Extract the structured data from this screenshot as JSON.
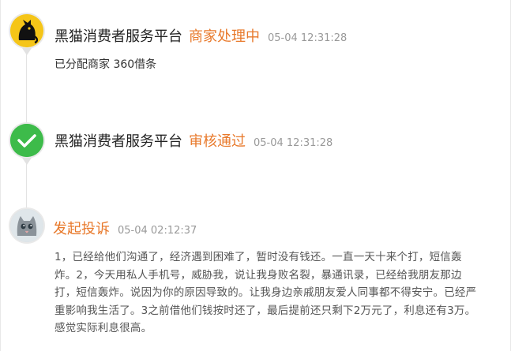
{
  "events": [
    {
      "platform": "黑猫消费者服务平台",
      "status": "商家处理中",
      "time": "05-04 12:31:28",
      "detail": "已分配商家 360借条",
      "icon": "black-cat-logo-icon"
    },
    {
      "platform": "黑猫消费者服务平台",
      "status": "审核通过",
      "time": "05-04 12:31:28",
      "icon": "check-circle-icon"
    }
  ],
  "complaint": {
    "title": "发起投诉",
    "time": "05-04 02:12:37",
    "avatar": "gray-cat-avatar-icon",
    "body_lines": [
      "1，已经给他们沟通了，经济遇到困难了，暂时没有钱还。一直一天十来个打，短信轰",
      "炸。2，今天用私人手机号，威胁我，说让我身败名裂，暴通讯录，已经给我朋友那边",
      "打，短信轰炸。说因为你的原因导致的。让我身边亲戚朋友爱人同事都不得安宁。已经严",
      "重影响我生活了。3之前借他们钱按时还了，最后提前还只剩下2万元了，利息还有3万。",
      "感觉实际利息很高。"
    ]
  },
  "colors": {
    "accent": "#e8792b",
    "success": "#3dbb4a",
    "logo_yellow": "#f5c518"
  }
}
